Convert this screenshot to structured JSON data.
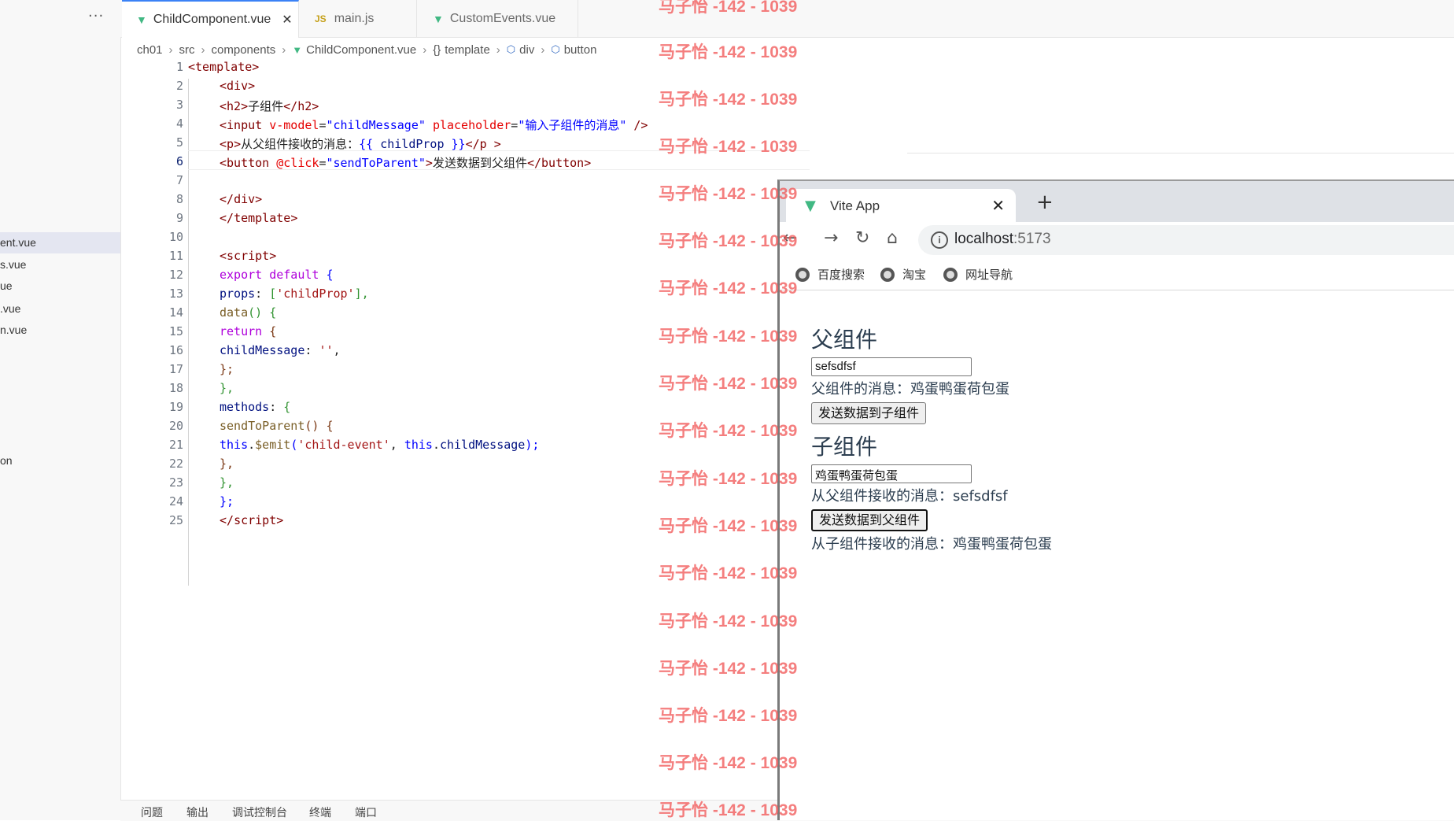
{
  "sidebar": {
    "more": "···",
    "files": [
      {
        "label": "ent.vue",
        "active": true
      },
      {
        "label": "s.vue",
        "active": false
      },
      {
        "label": "ue",
        "active": false
      },
      {
        "label": ".vue",
        "active": false
      },
      {
        "label": "n.vue",
        "active": false
      },
      {
        "label": "on",
        "active": false
      }
    ]
  },
  "tabs": [
    {
      "label": "ChildComponent.vue",
      "icon": "vue-icon",
      "active": true,
      "close": "✕"
    },
    {
      "label": "main.js",
      "icon": "js-icon",
      "icon_text": "JS",
      "active": false
    },
    {
      "label": "CustomEvents.vue",
      "icon": "vue-icon",
      "active": false
    }
  ],
  "breadcrumb": {
    "items": [
      "ch01",
      "src",
      "components",
      "ChildComponent.vue",
      "template",
      "div",
      "button"
    ],
    "sep": "›",
    "template_glyph": "{}"
  },
  "editor": {
    "current_line": 6,
    "line_numbers": [
      "1",
      "2",
      "3",
      "4",
      "5",
      "6",
      "7",
      "8",
      "9",
      "10",
      "11",
      "12",
      "13",
      "14",
      "15",
      "16",
      "17",
      "18",
      "19",
      "20",
      "21",
      "22",
      "23",
      "24",
      "25"
    ]
  },
  "panel": {
    "tabs": [
      "问题",
      "输出",
      "调试控制台",
      "终端",
      "端口"
    ]
  },
  "watermark": "马子怡 -142 - 1039",
  "browser": {
    "tab_title": "Vite App",
    "tab_close": "✕",
    "new_tab": "+",
    "url_host": "localhost",
    "url_port": ":5173",
    "info_glyph": "i",
    "bookmarks": [
      "百度搜索",
      "淘宝",
      "网址导航"
    ],
    "page": {
      "parent_title": "父组件",
      "parent_input": "sefsdfsf",
      "parent_msg": "父组件的消息：鸡蛋鸭蛋荷包蛋",
      "parent_btn": "发送数据到子组件",
      "child_title": "子组件",
      "child_input": "鸡蛋鸭蛋荷包蛋",
      "child_msg": "从父组件接收的消息：sefsdfsf",
      "child_btn": "发送数据到父组件",
      "from_child_msg": "从子组件接收的消息：鸡蛋鸭蛋荷包蛋"
    }
  },
  "code": {
    "l1": {
      "open": "<",
      "tag": "template",
      "close": ">"
    },
    "l2": {
      "open": "<",
      "tag": "div",
      "close": ">"
    },
    "l3": {
      "open": "<",
      "tag": "h2",
      "close": ">",
      "text": "子组件",
      "end": "</",
      "tag2": "h2",
      "close2": ">"
    },
    "l4": {
      "open": "<",
      "tag": "input",
      "attr1": "v-model",
      "eq": "=",
      "val1": "\"childMessage\"",
      "attr2": "placeholder",
      "val2": "\"输入子组件的消息\"",
      "end": " />"
    },
    "l5": {
      "open": "<",
      "tag": "p",
      "close": ">",
      "text": "从父组件接收的消息：",
      "mo": "{{",
      "expr": "childProp",
      "mc": "}}",
      "end": "</",
      "tag2": "p",
      "close2": " >"
    },
    "l6": {
      "open": "<",
      "tag": "button",
      "attr1": "@click",
      "eq": "=",
      "val1": "\"sendToParent\"",
      "close": ">",
      "text": "发送数据到父组件",
      "end": "</",
      "tag2": "button",
      "close2": ">"
    },
    "l8": {
      "end": "</",
      "tag": "div",
      "close": ">"
    },
    "l9": {
      "end": "</",
      "tag": "template",
      "close": ">"
    },
    "l11": {
      "open": "<",
      "tag": "script",
      "close": ">"
    },
    "l12": {
      "k1": "export",
      "k2": "default",
      "b": "{"
    },
    "l13": {
      "p": "props",
      "c": ":",
      "b": "[",
      "s": "'childProp'",
      "b2": "],"
    },
    "l14": {
      "f": "data",
      "pa": "()",
      "b": "{"
    },
    "l15": {
      "k": "return",
      "b": "{"
    },
    "l16": {
      "p": "childMessage",
      "c": ":",
      "s": "''",
      "e": ","
    },
    "l17": {
      "b": "};"
    },
    "l18": {
      "b": "},"
    },
    "l19": {
      "p": "methods",
      "c": ":",
      "b": "{"
    },
    "l20": {
      "f": "sendToParent",
      "pa": "()",
      "b": "{"
    },
    "l21": {
      "kw": "this",
      "dot": ".",
      "f": "$emit",
      "po": "(",
      "s": "'child-event'",
      "cm": ", ",
      "kw2": "this",
      "dot2": ".",
      "p": "childMessage",
      "pc": ");"
    },
    "l22": {
      "b": "},"
    },
    "l23": {
      "b": "},"
    },
    "l24": {
      "b": "};"
    },
    "l25": {
      "end": "</",
      "tag": "script",
      "close": ">"
    }
  }
}
